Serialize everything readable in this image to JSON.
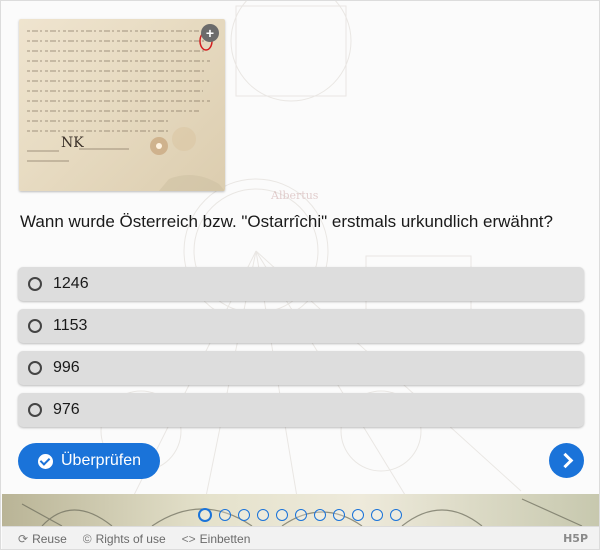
{
  "question": {
    "text": "Wann wurde Österreich bzw. \"Ostarrîchi\" erstmals urkundlich erwähnt?"
  },
  "image": {
    "zoom_icon": "plus-icon",
    "zoom_label": "+"
  },
  "answers": [
    {
      "label": "1246",
      "selected": false
    },
    {
      "label": "1153",
      "selected": false
    },
    {
      "label": "996",
      "selected": false
    },
    {
      "label": "976",
      "selected": false
    }
  ],
  "buttons": {
    "check_label": "Überprüfen",
    "check_icon": "check-circle-icon",
    "next_icon": "chevron-right-icon"
  },
  "progress": {
    "total_slides": 11,
    "current_slide": 1
  },
  "footer": {
    "reuse_label": "Reuse",
    "rights_label": "Rights of use",
    "embed_label": "Einbetten",
    "reuse_icon": "reuse-icon",
    "rights_icon": "copyright-icon",
    "embed_icon": "code-icon",
    "logo_text": "H5P"
  },
  "colors": {
    "accent": "#1a73d9",
    "answer_bg": "#dddddd"
  }
}
